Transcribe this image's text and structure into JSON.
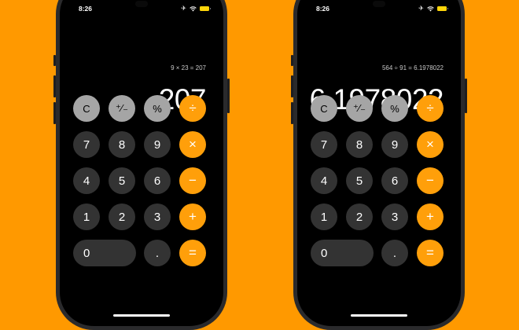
{
  "colors": {
    "background": "#FF9900",
    "operator_key": "#FF9F0A",
    "function_key": "#A5A5A5",
    "number_key": "#333333",
    "screen": "#000000"
  },
  "phones": [
    {
      "status": {
        "time": "8:26",
        "icons": [
          "airplane-icon",
          "wifi-icon",
          "battery-icon"
        ]
      },
      "history": "9 × 23 = 207",
      "display": "207"
    },
    {
      "status": {
        "time": "8:26",
        "icons": [
          "airplane-icon",
          "wifi-icon",
          "battery-icon"
        ]
      },
      "history": "564 ÷ 91 = 6.1978022",
      "display": "6.1978022"
    }
  ],
  "keypad": {
    "clear": "C",
    "plus_minus": "⁺∕₋",
    "percent": "%",
    "divide": "÷",
    "multiply": "×",
    "subtract": "−",
    "add": "+",
    "equals": "=",
    "decimal": ".",
    "digits": [
      "0",
      "1",
      "2",
      "3",
      "4",
      "5",
      "6",
      "7",
      "8",
      "9"
    ]
  }
}
